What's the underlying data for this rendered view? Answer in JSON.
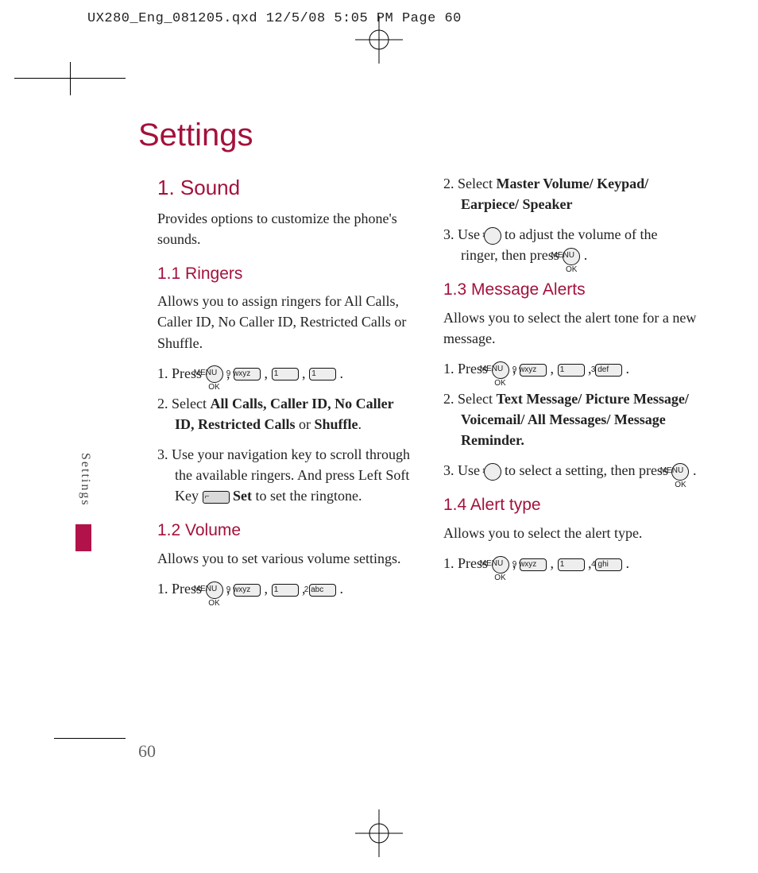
{
  "header": "UX280_Eng_081205.qxd  12/5/08  5:05 PM  Page 60",
  "title": "Settings",
  "sideTab": "Settings",
  "pageNumber": "60",
  "keys": {
    "ok": "MENU OK",
    "nine": "9 wxyz",
    "one": "1 ",
    "two": "2 abc",
    "three": "3 def",
    "four": "4 ghi",
    "nav": "↕",
    "softSet": "Set"
  },
  "left": {
    "sec1": "1. Sound",
    "sec1_p": "Provides options to customize the phone's sounds.",
    "sub11": "1.1 Ringers",
    "sub11_p": "Allows you to assign ringers for All Calls, Caller ID, No Caller ID, Restricted Calls or Shuffle.",
    "s11_1a": "1. Press ",
    "s11_2a": "2. Select ",
    "s11_2_bold": "All Calls, Caller ID, No Caller ID, Restricted Calls",
    "s11_2b": " or ",
    "s11_2_bold2": "Shuffle",
    "s11_2c": ".",
    "s11_3a": "3. Use your navigation key to scroll through the available ringers. And press Left Soft Key ",
    "s11_3b": " to set the ringtone.",
    "sub12": "1.2 Volume",
    "sub12_p": "Allows you to set various volume settings.",
    "s12_1a": "1. Press "
  },
  "right": {
    "s12_2a": "2. Select ",
    "s12_2_bold": "Master Volume/ Keypad/ Earpiece/ Speaker",
    "s12_3a": "3. Use ",
    "s12_3b": " to adjust the volume of the ringer, then press ",
    "s12_3c": " .",
    "sub13": "1.3 Message Alerts",
    "sub13_p": "Allows you to select the alert tone for a new message.",
    "s13_1a": "1. Press ",
    "s13_2a": "2. Select ",
    "s13_2_bold": "Text Message/ Picture Message/ Voicemail/ All Messages/ Message Reminder.",
    "s13_3a": "3. Use ",
    "s13_3b": " to select a setting, then press ",
    "s13_3c": ".",
    "sub14": "1.4 Alert type",
    "sub14_p": "Allows you to select the alert type.",
    "s14_1a": "1. Press "
  }
}
